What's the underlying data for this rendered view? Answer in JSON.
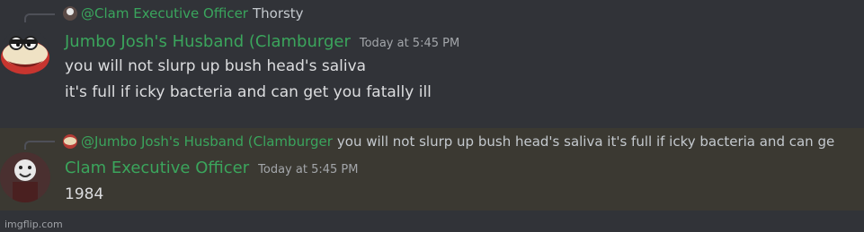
{
  "messages": [
    {
      "reply": {
        "username": "@Clam Executive Officer",
        "text": "Thorsty"
      },
      "username": "Jumbo Josh's Husband (Clamburger",
      "timestamp": "Today at 5:45 PM",
      "lines": [
        "you will not slurp up bush head's saliva",
        "it's full if icky bacteria and can get you fatally ill"
      ],
      "name_color": "#3ba55c"
    },
    {
      "reply": {
        "username": "@Jumbo Josh's Husband (Clamburger",
        "text": "you will not slurp up bush head's saliva it's full if icky bacteria and can ge"
      },
      "username": "Clam Executive Officer",
      "timestamp": "Today at 5:45 PM",
      "lines": [
        "1984"
      ],
      "name_color": "#3ba55c"
    }
  ],
  "watermark": "imgflip.com",
  "colors": {
    "background": "#313338",
    "highlight": "#3b3932",
    "username": "#3ba55c"
  }
}
